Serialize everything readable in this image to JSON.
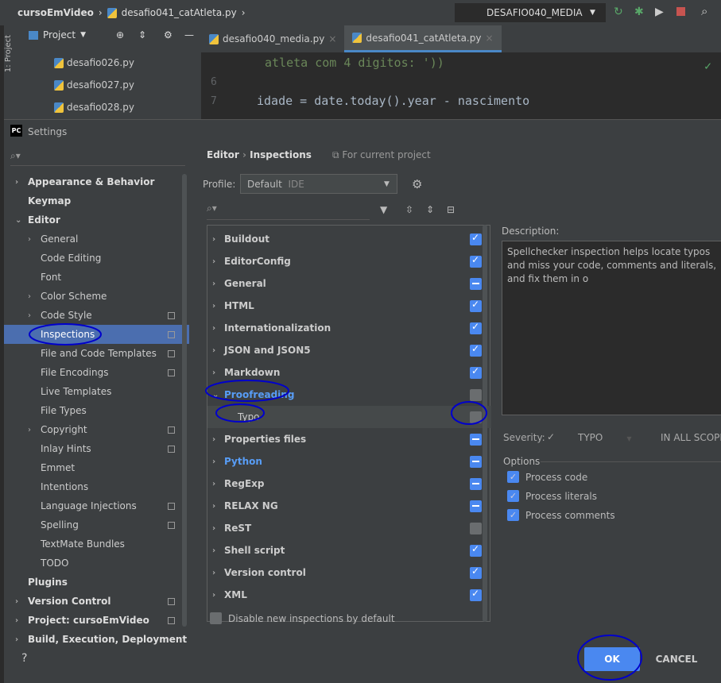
{
  "topbar": {
    "project": "cursoEmVideo",
    "file": "desafio041_catAtleta.py",
    "run_config": "DESAFIO040_MEDIA"
  },
  "project_panel": {
    "title": "Project",
    "strip_label": "1: Project",
    "files": [
      "desafio026.py",
      "desafio027.py",
      "desafio028.py"
    ]
  },
  "editor": {
    "tabs": [
      "desafio040_media.py",
      "desafio041_catAtleta.py"
    ],
    "lines": [
      {
        "num": "",
        "text": "atleta com 4 digitos: '))"
      },
      {
        "num": "6",
        "text": ""
      },
      {
        "num": "7",
        "text": "idade = date.today().year - nascimento"
      }
    ]
  },
  "dialog": {
    "title": "Settings",
    "logo": "PC",
    "tree": [
      {
        "label": "Appearance & Behavior",
        "level": 0,
        "bold": true,
        "chev": "›"
      },
      {
        "label": "Keymap",
        "level": 0,
        "bold": true,
        "chev": ""
      },
      {
        "label": "Editor",
        "level": 0,
        "bold": true,
        "chev": "⌄"
      },
      {
        "label": "General",
        "level": 1,
        "chev": "›"
      },
      {
        "label": "Code Editing",
        "level": 1,
        "chev": ""
      },
      {
        "label": "Font",
        "level": 1,
        "chev": ""
      },
      {
        "label": "Color Scheme",
        "level": 1,
        "chev": "›"
      },
      {
        "label": "Code Style",
        "level": 1,
        "chev": "›",
        "copy": true
      },
      {
        "label": "Inspections",
        "level": 1,
        "chev": "",
        "copy": true,
        "selected": true
      },
      {
        "label": "File and Code Templates",
        "level": 1,
        "chev": "",
        "copy": true
      },
      {
        "label": "File Encodings",
        "level": 1,
        "chev": "",
        "copy": true
      },
      {
        "label": "Live Templates",
        "level": 1,
        "chev": ""
      },
      {
        "label": "File Types",
        "level": 1,
        "chev": ""
      },
      {
        "label": "Copyright",
        "level": 1,
        "chev": "›",
        "copy": true
      },
      {
        "label": "Inlay Hints",
        "level": 1,
        "chev": "",
        "copy": true
      },
      {
        "label": "Emmet",
        "level": 1,
        "chev": ""
      },
      {
        "label": "Intentions",
        "level": 1,
        "chev": ""
      },
      {
        "label": "Language Injections",
        "level": 1,
        "chev": "",
        "copy": true
      },
      {
        "label": "Spelling",
        "level": 1,
        "chev": "",
        "copy": true
      },
      {
        "label": "TextMate Bundles",
        "level": 1,
        "chev": ""
      },
      {
        "label": "TODO",
        "level": 1,
        "chev": ""
      },
      {
        "label": "Plugins",
        "level": 0,
        "bold": true,
        "chev": ""
      },
      {
        "label": "Version Control",
        "level": 0,
        "bold": true,
        "chev": "›",
        "copy": true
      },
      {
        "label": "Project: cursoEmVideo",
        "level": 0,
        "bold": true,
        "chev": "›",
        "copy": true
      },
      {
        "label": "Build, Execution, Deployment",
        "level": 0,
        "bold": true,
        "chev": "›"
      }
    ],
    "breadcrumb": [
      "Editor",
      "Inspections"
    ],
    "scope_note": "For current project",
    "profile_label": "Profile:",
    "profile_value": "Default",
    "profile_suffix": "IDE",
    "inspections": [
      {
        "label": "Buildout",
        "state": "on"
      },
      {
        "label": "EditorConfig",
        "state": "on"
      },
      {
        "label": "General",
        "state": "mixed"
      },
      {
        "label": "HTML",
        "state": "on"
      },
      {
        "label": "Internationalization",
        "state": "on"
      },
      {
        "label": "JSON and JSON5",
        "state": "on"
      },
      {
        "label": "Markdown",
        "state": "on"
      },
      {
        "label": "Proofreading",
        "state": "off",
        "expanded": true,
        "accent": true
      },
      {
        "label": "Typo",
        "state": "off",
        "child": true
      },
      {
        "label": "Properties files",
        "state": "mixed"
      },
      {
        "label": "Python",
        "state": "mixed",
        "accent": true
      },
      {
        "label": "RegExp",
        "state": "mixed"
      },
      {
        "label": "RELAX NG",
        "state": "mixed"
      },
      {
        "label": "ReST",
        "state": "off"
      },
      {
        "label": "Shell script",
        "state": "on"
      },
      {
        "label": "Version control",
        "state": "on"
      },
      {
        "label": "XML",
        "state": "on"
      }
    ],
    "disable_new": "Disable new inspections by default",
    "description_label": "Description:",
    "description": "Spellchecker inspection helps locate typos and miss your code, comments and literals, and fix them in o",
    "severity_label": "Severity:",
    "severity": "TYPO",
    "scope": "IN ALL SCOPES",
    "options_label": "Options",
    "options": [
      "Process code",
      "Process literals",
      "Process comments"
    ],
    "help": "?",
    "ok": "OK",
    "cancel": "CANCEL"
  },
  "colors": {
    "accent": "#4a88c7",
    "selection": "#4b6eaf",
    "checkbox": "#4a88f0",
    "annotation": "#0000cc"
  }
}
